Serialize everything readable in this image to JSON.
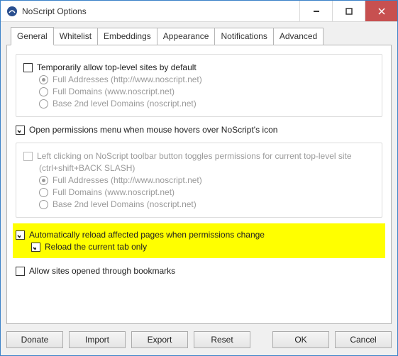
{
  "title": "NoScript Options",
  "tabs": [
    "General",
    "Whitelist",
    "Embeddings",
    "Appearance",
    "Notifications",
    "Advanced"
  ],
  "groupA": {
    "temp_allow": "Temporarily allow top-level sites by default",
    "full_addr": "Full Addresses (http://www.noscript.net)",
    "full_dom": "Full Domains (www.noscript.net)",
    "base_dom": "Base 2nd level Domains (noscript.net)"
  },
  "open_perm": "Open permissions menu when mouse hovers over NoScript's icon",
  "groupB": {
    "left_click": "Left clicking on NoScript toolbar button toggles permissions for current top-level site",
    "shortcut": "(ctrl+shift+BACK SLASH)",
    "full_addr": "Full Addresses (http://www.noscript.net)",
    "full_dom": "Full Domains (www.noscript.net)",
    "base_dom": "Base 2nd level Domains (noscript.net)"
  },
  "auto_reload": "Automatically reload affected pages when permissions change",
  "reload_tab": "Reload the current tab only",
  "allow_bookmarks": "Allow sites opened through bookmarks",
  "buttons": {
    "donate": "Donate",
    "import": "Import",
    "export": "Export",
    "reset": "Reset",
    "ok": "OK",
    "cancel": "Cancel"
  }
}
